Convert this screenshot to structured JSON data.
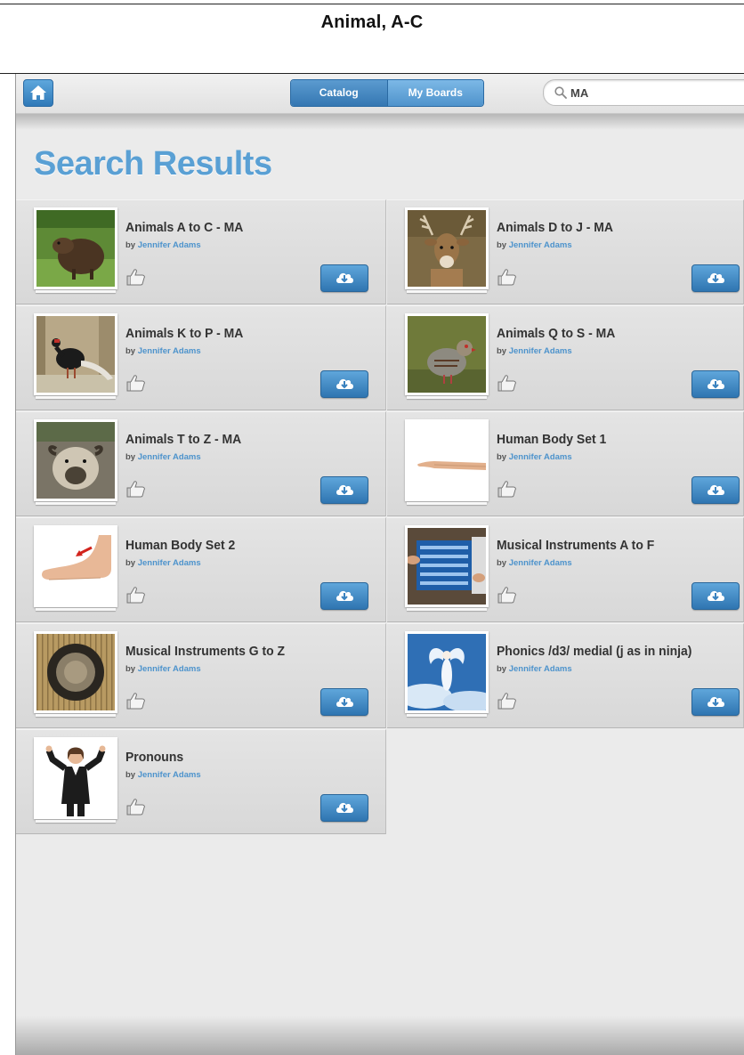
{
  "document": {
    "title": "Animal,  A-C"
  },
  "toolbar": {
    "tabs": [
      {
        "label": "Catalog",
        "active": true
      },
      {
        "label": "My Boards",
        "active": false
      }
    ],
    "search": {
      "value": "MA"
    }
  },
  "page": {
    "heading": "Search Results"
  },
  "results": [
    {
      "title": "Animals A to C - MA",
      "by": "by",
      "author": "Jennifer Adams",
      "thumbnail": "agouti-photo"
    },
    {
      "title": "Animals D to J - MA",
      "by": "by",
      "author": "Jennifer Adams",
      "thumbnail": "deer-photo"
    },
    {
      "title": "Animals K to P - MA",
      "by": "by",
      "author": "Jennifer Adams",
      "thumbnail": "pheasant-photo"
    },
    {
      "title": "Animals Q to S - MA",
      "by": "by",
      "author": "Jennifer Adams",
      "thumbnail": "partridge-photo"
    },
    {
      "title": "Animals T to Z - MA",
      "by": "by",
      "author": "Jennifer Adams",
      "thumbnail": "takin-photo"
    },
    {
      "title": "Human Body Set 1",
      "by": "by",
      "author": "Jennifer Adams",
      "thumbnail": "arm-photo"
    },
    {
      "title": "Human Body Set 2",
      "by": "by",
      "author": "Jennifer Adams",
      "thumbnail": "foot-photo"
    },
    {
      "title": "Musical Instruments A to F",
      "by": "by",
      "author": "Jennifer Adams",
      "thumbnail": "accordion-photo"
    },
    {
      "title": "Musical Instruments G to Z",
      "by": "by",
      "author": "Jennifer Adams",
      "thumbnail": "gong-photo"
    },
    {
      "title": "Phonics /d3/ medial (j as in ninja)",
      "by": "by",
      "author": "Jennifer Adams",
      "thumbnail": "angel-photo"
    },
    {
      "title": "Pronouns",
      "by": "by",
      "author": "Jennifer Adams",
      "thumbnail": "woman-pointing-photo"
    }
  ],
  "icons": {
    "home": "home-icon",
    "search": "search-icon",
    "like": "thumbs-up-icon",
    "download": "cloud-download-icon"
  },
  "colors": {
    "accent": "#5aa0d4",
    "button": "#3a82bf",
    "author": "#4d93cc"
  }
}
